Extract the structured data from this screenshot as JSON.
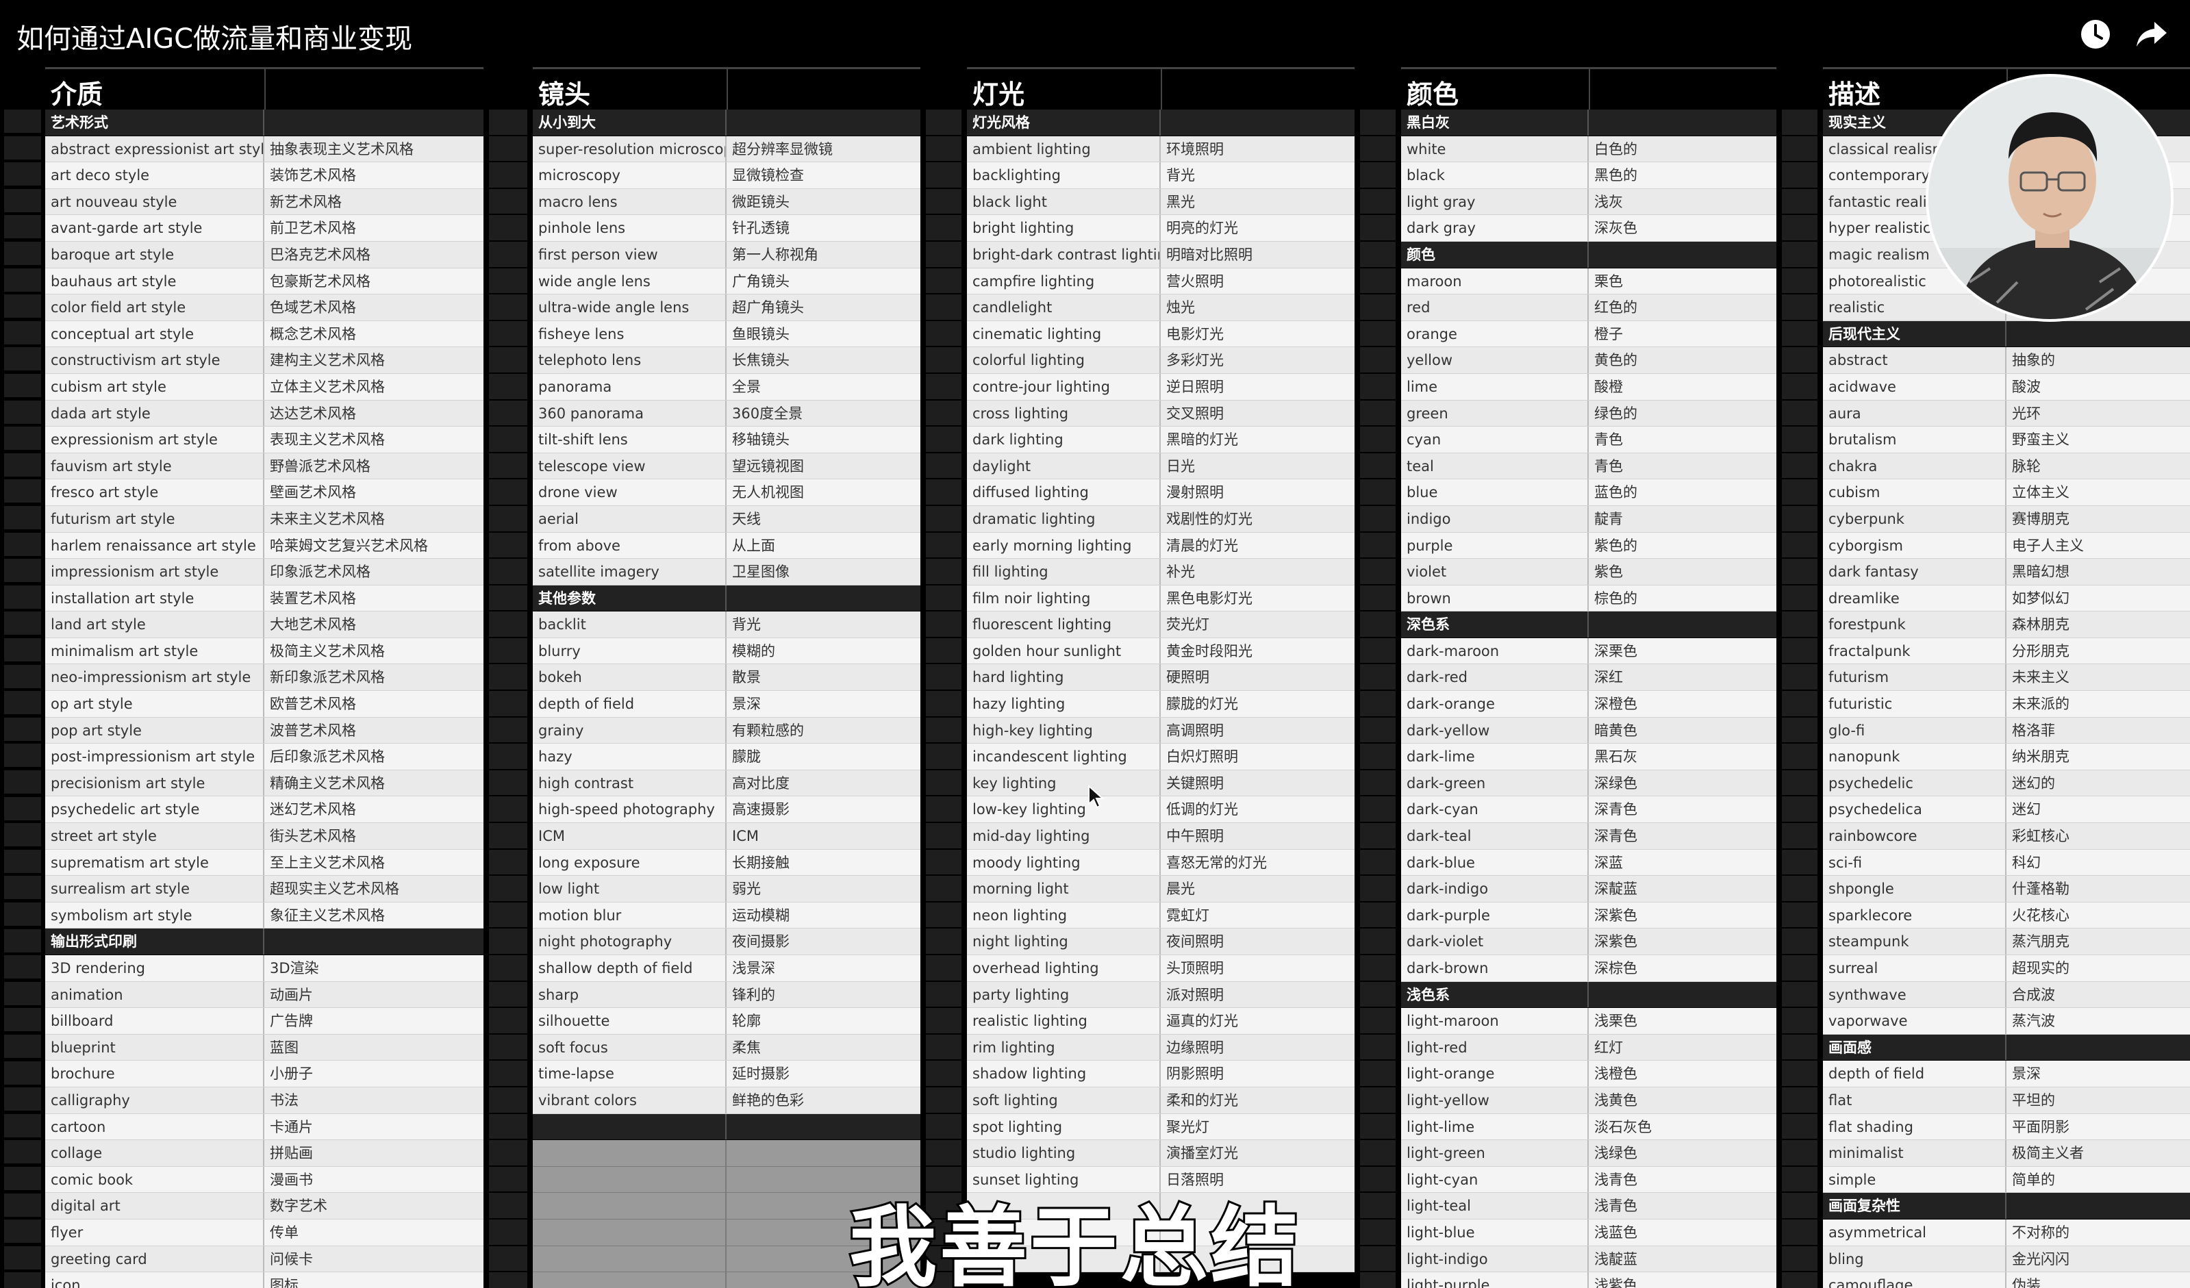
{
  "video_title": "如何通过AIGC做流量和商业变现",
  "subtitle": "我善于总结",
  "columns": [
    {
      "header": "介质",
      "rows": [
        {
          "en": "艺术形式",
          "zh": "",
          "section": true
        },
        {
          "en": "abstract expressionist art style",
          "zh": "抽象表现主义艺术风格"
        },
        {
          "en": "art deco style",
          "zh": "装饰艺术风格"
        },
        {
          "en": "art nouveau style",
          "zh": "新艺术风格"
        },
        {
          "en": "avant-garde art style",
          "zh": "前卫艺术风格"
        },
        {
          "en": "baroque art style",
          "zh": "巴洛克艺术风格"
        },
        {
          "en": "bauhaus art style",
          "zh": "包豪斯艺术风格"
        },
        {
          "en": "color field art style",
          "zh": "色域艺术风格"
        },
        {
          "en": "conceptual art style",
          "zh": "概念艺术风格"
        },
        {
          "en": "constructivism art style",
          "zh": "建构主义艺术风格"
        },
        {
          "en": "cubism art style",
          "zh": "立体主义艺术风格"
        },
        {
          "en": "dada art style",
          "zh": "达达艺术风格"
        },
        {
          "en": "expressionism art style",
          "zh": "表现主义艺术风格"
        },
        {
          "en": "fauvism art style",
          "zh": "野兽派艺术风格"
        },
        {
          "en": "fresco art style",
          "zh": "壁画艺术风格"
        },
        {
          "en": "futurism art style",
          "zh": "未来主义艺术风格"
        },
        {
          "en": "harlem renaissance art style",
          "zh": "哈莱姆文艺复兴艺术风格"
        },
        {
          "en": "impressionism art style",
          "zh": "印象派艺术风格"
        },
        {
          "en": "installation art style",
          "zh": "装置艺术风格"
        },
        {
          "en": "land art style",
          "zh": "大地艺术风格"
        },
        {
          "en": "minimalism art style",
          "zh": "极简主义艺术风格"
        },
        {
          "en": "neo-impressionism art style",
          "zh": "新印象派艺术风格"
        },
        {
          "en": "op art style",
          "zh": "欧普艺术风格"
        },
        {
          "en": "pop art style",
          "zh": "波普艺术风格"
        },
        {
          "en": "post-impressionism art style",
          "zh": "后印象派艺术风格"
        },
        {
          "en": "precisionism art style",
          "zh": "精确主义艺术风格"
        },
        {
          "en": "psychedelic art style",
          "zh": "迷幻艺术风格"
        },
        {
          "en": "street art style",
          "zh": "街头艺术风格"
        },
        {
          "en": "suprematism art style",
          "zh": "至上主义艺术风格"
        },
        {
          "en": "surrealism art style",
          "zh": "超现实主义艺术风格"
        },
        {
          "en": "symbolism art style",
          "zh": "象征主义艺术风格"
        },
        {
          "en": "输出形式印刷",
          "zh": "",
          "section": true
        },
        {
          "en": "3D rendering",
          "zh": "3D渲染"
        },
        {
          "en": "animation",
          "zh": "动画片"
        },
        {
          "en": "billboard",
          "zh": "广告牌"
        },
        {
          "en": "blueprint",
          "zh": "蓝图"
        },
        {
          "en": "brochure",
          "zh": "小册子"
        },
        {
          "en": "calligraphy",
          "zh": "书法"
        },
        {
          "en": "cartoon",
          "zh": "卡通片"
        },
        {
          "en": "collage",
          "zh": "拼贴画"
        },
        {
          "en": "comic book",
          "zh": "漫画书"
        },
        {
          "en": "digital art",
          "zh": "数字艺术"
        },
        {
          "en": "flyer",
          "zh": "传单"
        },
        {
          "en": "greeting card",
          "zh": "问候卡"
        },
        {
          "en": "icon",
          "zh": "图标"
        }
      ]
    },
    {
      "header": "镜头",
      "rows": [
        {
          "en": "从小到大",
          "zh": "",
          "section": true
        },
        {
          "en": "super-resolution microscopy",
          "zh": "超分辨率显微镜"
        },
        {
          "en": "microscopy",
          "zh": "显微镜检查"
        },
        {
          "en": "macro lens",
          "zh": "微距镜头"
        },
        {
          "en": "pinhole lens",
          "zh": "针孔透镜"
        },
        {
          "en": "first person view",
          "zh": "第一人称视角"
        },
        {
          "en": "wide angle lens",
          "zh": "广角镜头"
        },
        {
          "en": "ultra-wide angle lens",
          "zh": "超广角镜头"
        },
        {
          "en": "fisheye lens",
          "zh": "鱼眼镜头"
        },
        {
          "en": "telephoto lens",
          "zh": "长焦镜头"
        },
        {
          "en": "panorama",
          "zh": "全景"
        },
        {
          "en": "360 panorama",
          "zh": "360度全景"
        },
        {
          "en": "tilt-shift lens",
          "zh": "移轴镜头"
        },
        {
          "en": "telescope view",
          "zh": "望远镜视图"
        },
        {
          "en": "drone view",
          "zh": "无人机视图"
        },
        {
          "en": "aerial",
          "zh": "天线"
        },
        {
          "en": "from above",
          "zh": "从上面"
        },
        {
          "en": "satellite imagery",
          "zh": "卫星图像"
        },
        {
          "en": "其他参数",
          "zh": "",
          "section": true
        },
        {
          "en": "backlit",
          "zh": "背光"
        },
        {
          "en": "blurry",
          "zh": "模糊的"
        },
        {
          "en": "bokeh",
          "zh": "散景"
        },
        {
          "en": "depth of field",
          "zh": "景深"
        },
        {
          "en": "grainy",
          "zh": "有颗粒感的"
        },
        {
          "en": "hazy",
          "zh": "朦胧"
        },
        {
          "en": "high contrast",
          "zh": "高对比度"
        },
        {
          "en": "high-speed photography",
          "zh": "高速摄影"
        },
        {
          "en": "ICM",
          "zh": "ICM"
        },
        {
          "en": "long exposure",
          "zh": "长期接触"
        },
        {
          "en": "low light",
          "zh": "弱光"
        },
        {
          "en": "motion blur",
          "zh": "运动模糊"
        },
        {
          "en": "night photography",
          "zh": "夜间摄影"
        },
        {
          "en": "shallow depth of field",
          "zh": "浅景深"
        },
        {
          "en": "sharp",
          "zh": "锋利的"
        },
        {
          "en": "silhouette",
          "zh": "轮廓"
        },
        {
          "en": "soft focus",
          "zh": "柔焦"
        },
        {
          "en": "time-lapse",
          "zh": "延时摄影"
        },
        {
          "en": "vibrant colors",
          "zh": "鲜艳的色彩"
        },
        {
          "en": "",
          "zh": "",
          "section": true
        },
        {
          "en": "",
          "zh": "",
          "gray": true
        },
        {
          "en": "",
          "zh": "",
          "gray": true
        },
        {
          "en": "",
          "zh": "",
          "gray": true
        },
        {
          "en": "",
          "zh": "",
          "gray": true
        },
        {
          "en": "",
          "zh": "",
          "gray": true
        },
        {
          "en": "",
          "zh": "",
          "gray": true
        }
      ]
    },
    {
      "header": "灯光",
      "rows": [
        {
          "en": "灯光风格",
          "zh": "",
          "section": true
        },
        {
          "en": "ambient lighting",
          "zh": "环境照明"
        },
        {
          "en": "backlighting",
          "zh": "背光"
        },
        {
          "en": "black light",
          "zh": "黑光"
        },
        {
          "en": "bright lighting",
          "zh": "明亮的灯光"
        },
        {
          "en": "bright-dark contrast lighting",
          "zh": "明暗对比照明"
        },
        {
          "en": "campfire lighting",
          "zh": "营火照明"
        },
        {
          "en": "candlelight",
          "zh": "烛光"
        },
        {
          "en": "cinematic lighting",
          "zh": "电影灯光"
        },
        {
          "en": "colorful lighting",
          "zh": "多彩灯光"
        },
        {
          "en": "contre-jour lighting",
          "zh": "逆日照明"
        },
        {
          "en": "cross lighting",
          "zh": "交叉照明"
        },
        {
          "en": "dark lighting",
          "zh": "黑暗的灯光"
        },
        {
          "en": "daylight",
          "zh": "日光"
        },
        {
          "en": "diffused lighting",
          "zh": "漫射照明"
        },
        {
          "en": "dramatic lighting",
          "zh": "戏剧性的灯光"
        },
        {
          "en": "early morning lighting",
          "zh": "清晨的灯光"
        },
        {
          "en": "fill lighting",
          "zh": "补光"
        },
        {
          "en": "film noir lighting",
          "zh": "黑色电影灯光"
        },
        {
          "en": "fluorescent lighting",
          "zh": "荧光灯"
        },
        {
          "en": "golden hour sunlight",
          "zh": "黄金时段阳光"
        },
        {
          "en": "hard lighting",
          "zh": "硬照明"
        },
        {
          "en": "hazy lighting",
          "zh": "朦胧的灯光"
        },
        {
          "en": "high-key lighting",
          "zh": "高调照明"
        },
        {
          "en": "incandescent lighting",
          "zh": "白炽灯照明"
        },
        {
          "en": "key lighting",
          "zh": "关键照明"
        },
        {
          "en": "low-key lighting",
          "zh": "低调的灯光"
        },
        {
          "en": "mid-day lighting",
          "zh": "中午照明"
        },
        {
          "en": "moody lighting",
          "zh": "喜怒无常的灯光"
        },
        {
          "en": "morning light",
          "zh": "晨光"
        },
        {
          "en": "neon lighting",
          "zh": "霓虹灯"
        },
        {
          "en": "night lighting",
          "zh": "夜间照明"
        },
        {
          "en": "overhead lighting",
          "zh": "头顶照明"
        },
        {
          "en": "party lighting",
          "zh": "派对照明"
        },
        {
          "en": "realistic lighting",
          "zh": "逼真的灯光"
        },
        {
          "en": "rim lighting",
          "zh": "边缘照明"
        },
        {
          "en": "shadow lighting",
          "zh": "阴影照明"
        },
        {
          "en": "soft lighting",
          "zh": "柔和的灯光"
        },
        {
          "en": "spot lighting",
          "zh": "聚光灯"
        },
        {
          "en": "studio lighting",
          "zh": "演播室灯光"
        },
        {
          "en": "sunset lighting",
          "zh": "日落照明"
        },
        {
          "en": "",
          "zh": ""
        },
        {
          "en": "",
          "zh": ""
        },
        {
          "en": "",
          "zh": ""
        }
      ]
    },
    {
      "header": "颜色",
      "rows": [
        {
          "en": "黑白灰",
          "zh": "",
          "section": true
        },
        {
          "en": "white",
          "zh": "白色的"
        },
        {
          "en": "black",
          "zh": "黑色的"
        },
        {
          "en": "light gray",
          "zh": "浅灰"
        },
        {
          "en": "dark gray",
          "zh": "深灰色"
        },
        {
          "en": "颜色",
          "zh": "",
          "section": true
        },
        {
          "en": "maroon",
          "zh": "栗色"
        },
        {
          "en": "red",
          "zh": "红色的"
        },
        {
          "en": "orange",
          "zh": "橙子"
        },
        {
          "en": "yellow",
          "zh": "黄色的"
        },
        {
          "en": "lime",
          "zh": "酸橙"
        },
        {
          "en": "green",
          "zh": "绿色的"
        },
        {
          "en": "cyan",
          "zh": "青色"
        },
        {
          "en": "teal",
          "zh": "青色"
        },
        {
          "en": "blue",
          "zh": "蓝色的"
        },
        {
          "en": "indigo",
          "zh": "靛青"
        },
        {
          "en": "purple",
          "zh": "紫色的"
        },
        {
          "en": "violet",
          "zh": "紫色"
        },
        {
          "en": "brown",
          "zh": "棕色的"
        },
        {
          "en": "深色系",
          "zh": "",
          "section": true
        },
        {
          "en": "dark-maroon",
          "zh": "深栗色"
        },
        {
          "en": "dark-red",
          "zh": "深红"
        },
        {
          "en": "dark-orange",
          "zh": "深橙色"
        },
        {
          "en": "dark-yellow",
          "zh": "暗黄色"
        },
        {
          "en": "dark-lime",
          "zh": "黑石灰"
        },
        {
          "en": "dark-green",
          "zh": "深绿色"
        },
        {
          "en": "dark-cyan",
          "zh": "深青色"
        },
        {
          "en": "dark-teal",
          "zh": "深青色"
        },
        {
          "en": "dark-blue",
          "zh": "深蓝"
        },
        {
          "en": "dark-indigo",
          "zh": "深靛蓝"
        },
        {
          "en": "dark-purple",
          "zh": "深紫色"
        },
        {
          "en": "dark-violet",
          "zh": "深紫色"
        },
        {
          "en": "dark-brown",
          "zh": "深棕色"
        },
        {
          "en": "浅色系",
          "zh": "",
          "section": true
        },
        {
          "en": "light-maroon",
          "zh": "浅栗色"
        },
        {
          "en": "light-red",
          "zh": "红灯"
        },
        {
          "en": "light-orange",
          "zh": "浅橙色"
        },
        {
          "en": "light-yellow",
          "zh": "浅黄色"
        },
        {
          "en": "light-lime",
          "zh": "淡石灰色"
        },
        {
          "en": "light-green",
          "zh": "浅绿色"
        },
        {
          "en": "light-cyan",
          "zh": "浅青色"
        },
        {
          "en": "light-teal",
          "zh": "浅青色"
        },
        {
          "en": "light-blue",
          "zh": "浅蓝色"
        },
        {
          "en": "light-indigo",
          "zh": "浅靛蓝"
        },
        {
          "en": "light-purple",
          "zh": "浅紫色"
        }
      ]
    },
    {
      "header": "描述",
      "rows": [
        {
          "en": "现实主义",
          "zh": "",
          "section": true
        },
        {
          "en": "classical realism",
          "zh": ""
        },
        {
          "en": "contemporary r",
          "zh": ""
        },
        {
          "en": "fantastic realis",
          "zh": ""
        },
        {
          "en": "hyper realistic",
          "zh": ""
        },
        {
          "en": "magic realism",
          "zh": ""
        },
        {
          "en": "photorealistic",
          "zh": ""
        },
        {
          "en": "realistic",
          "zh": ""
        },
        {
          "en": "后现代主义",
          "zh": "",
          "section": true
        },
        {
          "en": "abstract",
          "zh": "抽象的"
        },
        {
          "en": "acidwave",
          "zh": "酸波"
        },
        {
          "en": "aura",
          "zh": "光环"
        },
        {
          "en": "brutalism",
          "zh": "野蛮主义"
        },
        {
          "en": "chakra",
          "zh": "脉轮"
        },
        {
          "en": "cubism",
          "zh": "立体主义"
        },
        {
          "en": "cyberpunk",
          "zh": "赛博朋克"
        },
        {
          "en": "cyborgism",
          "zh": "电子人主义"
        },
        {
          "en": "dark fantasy",
          "zh": "黑暗幻想"
        },
        {
          "en": "dreamlike",
          "zh": "如梦似幻"
        },
        {
          "en": "forestpunk",
          "zh": "森林朋克"
        },
        {
          "en": "fractalpunk",
          "zh": "分形朋克"
        },
        {
          "en": "futurism",
          "zh": "未来主义"
        },
        {
          "en": "futuristic",
          "zh": "未来派的"
        },
        {
          "en": "glo-fi",
          "zh": "格洛菲"
        },
        {
          "en": "nanopunk",
          "zh": "纳米朋克"
        },
        {
          "en": "psychedelic",
          "zh": "迷幻的"
        },
        {
          "en": "psychedelica",
          "zh": "迷幻"
        },
        {
          "en": "rainbowcore",
          "zh": "彩虹核心"
        },
        {
          "en": "sci-fi",
          "zh": "科幻"
        },
        {
          "en": "shpongle",
          "zh": "什蓬格勒"
        },
        {
          "en": "sparklecore",
          "zh": "火花核心"
        },
        {
          "en": "steampunk",
          "zh": "蒸汽朋克"
        },
        {
          "en": "surreal",
          "zh": "超现实的"
        },
        {
          "en": "synthwave",
          "zh": "合成波"
        },
        {
          "en": "vaporwave",
          "zh": "蒸汽波"
        },
        {
          "en": "画面感",
          "zh": "",
          "section": true
        },
        {
          "en": "depth of field",
          "zh": "景深"
        },
        {
          "en": "flat",
          "zh": "平坦的"
        },
        {
          "en": "flat shading",
          "zh": "平面阴影"
        },
        {
          "en": "minimalist",
          "zh": "极简主义者"
        },
        {
          "en": "simple",
          "zh": "简单的"
        },
        {
          "en": "画面复杂性",
          "zh": "",
          "section": true
        },
        {
          "en": "asymmetrical",
          "zh": "不对称的"
        },
        {
          "en": "bling",
          "zh": "金光闪闪"
        },
        {
          "en": "camouflage",
          "zh": "伪装"
        }
      ]
    }
  ]
}
